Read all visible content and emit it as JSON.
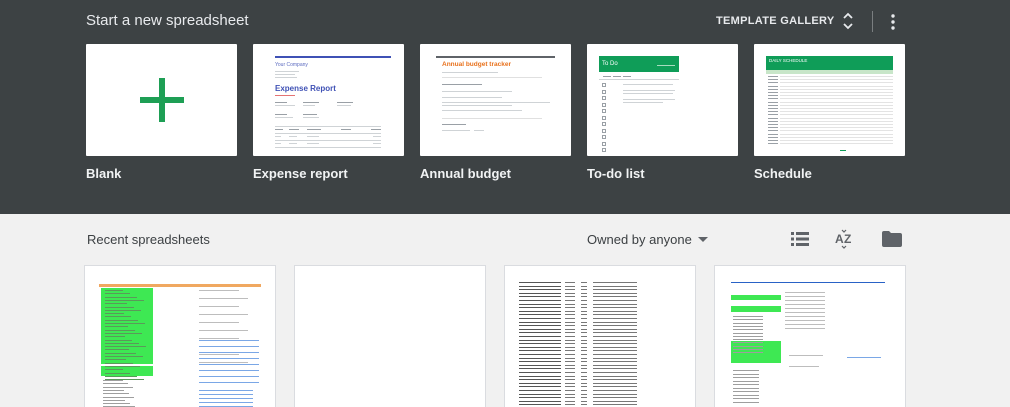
{
  "templates": {
    "title": "Start a new spreadsheet",
    "gallery_label": "TEMPLATE GALLERY",
    "items": [
      {
        "label": "Blank"
      },
      {
        "label": "Expense report",
        "company": "Your Company",
        "doc_title": "Expense Report"
      },
      {
        "label": "Annual budget",
        "doc_title": "Annual budget tracker"
      },
      {
        "label": "To-do list",
        "doc_title": "To Do"
      },
      {
        "label": "Schedule",
        "doc_title": "DAILY SCHEDULE"
      }
    ]
  },
  "recent": {
    "title": "Recent spreadsheets",
    "owner_filter": "Owned by anyone"
  },
  "icons": {
    "unfold": "unfold-more-icon",
    "more": "more-vert-icon",
    "list_view": "list-view-icon",
    "sort": "sort-az-icon",
    "folder": "folder-icon"
  },
  "colors": {
    "header_bg": "#3d4244",
    "page_bg": "#f1f1f1",
    "sheets_green": "#1e9f55",
    "expense_blue": "#3f51b5",
    "budget_orange": "#e8711c",
    "todo_green": "#0f9d58"
  }
}
